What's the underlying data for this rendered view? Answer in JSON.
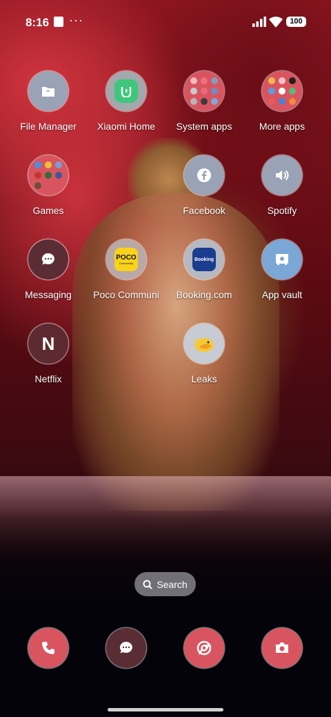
{
  "status_bar": {
    "time": "8:16",
    "more": "···",
    "battery": "100"
  },
  "apps": {
    "file_manager": "File Manager",
    "xiaomi_home": "Xiaomi Home",
    "system_apps": "System apps",
    "more_apps": "More apps",
    "games": "Games",
    "facebook": "Facebook",
    "spotify": "Spotify",
    "messaging": "Messaging",
    "poco_community": "Poco Communi",
    "booking": "Booking.com",
    "app_vault": "App vault",
    "netflix": "Netflix",
    "leaks": "Leaks"
  },
  "icon_text": {
    "poco": "POCO",
    "poco_sub": "Community",
    "booking": "Booking",
    "netflix": "N"
  },
  "search": {
    "label": "Search"
  },
  "colors": {
    "icon_red": "#d85560",
    "icon_grey": "#9aa3b5",
    "icon_dark": "#5a2d35",
    "icon_blue": "#7aa7d6"
  }
}
